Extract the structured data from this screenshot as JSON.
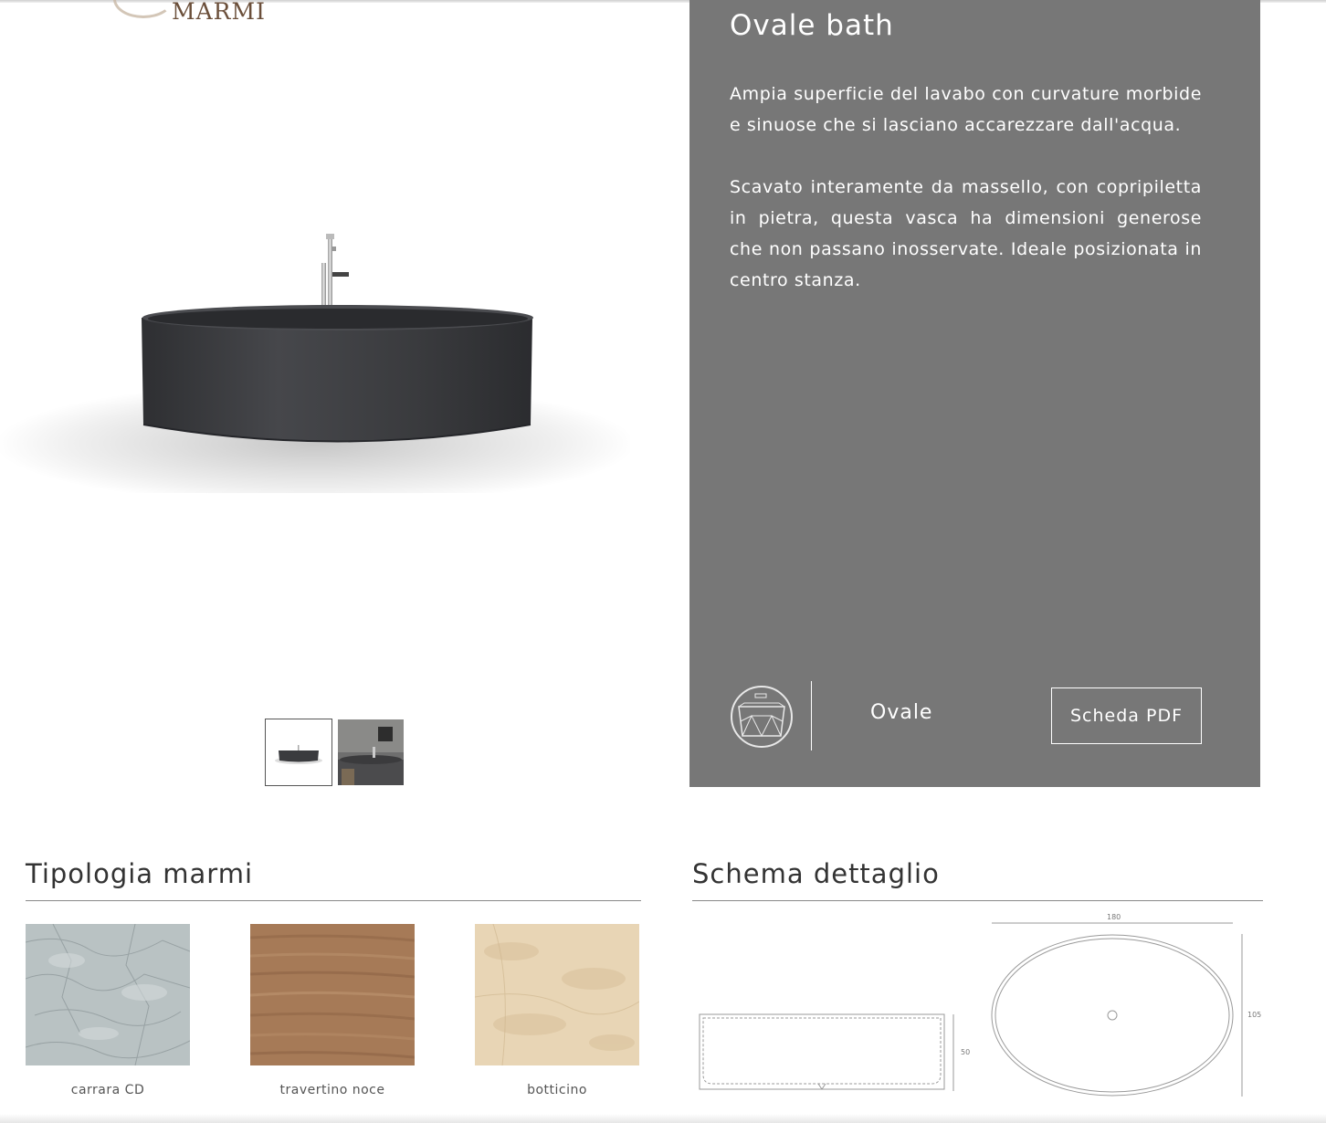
{
  "brand": {
    "logo_text": "MARMI",
    "logo_icon": "swirl-logo-icon"
  },
  "product": {
    "title": "Ovale bath",
    "description": [
      "Ampia superficie del lavabo con curvature morbide e sinuose che si lasciano accarezzare dall'acqua.",
      "Scavato interamente da massello, con copripiletta in pietra, questa vasca ha dimensioni generose che non passano inosservate. Ideale posizionata in centro stanza."
    ],
    "model_name": "Ovale",
    "model_icon": "bathtub-outline-icon",
    "pdf_button": "Scheda PDF",
    "thumbnail_count": 2,
    "active_thumbnail": 1
  },
  "marble": {
    "title": "Tipologia marmi",
    "items": [
      {
        "name": "carrara CD",
        "color": "#b9c2c3"
      },
      {
        "name": "travertino noce",
        "color": "#a67a57"
      },
      {
        "name": "botticino",
        "color": "#e8d5b5"
      }
    ]
  },
  "schema": {
    "title": "Schema dettaglio",
    "dims": {
      "width": "180",
      "depth": "105",
      "height": "50"
    }
  },
  "colors": {
    "panel": "#777777",
    "tub": "#3a3b3e",
    "text": "#333333"
  }
}
